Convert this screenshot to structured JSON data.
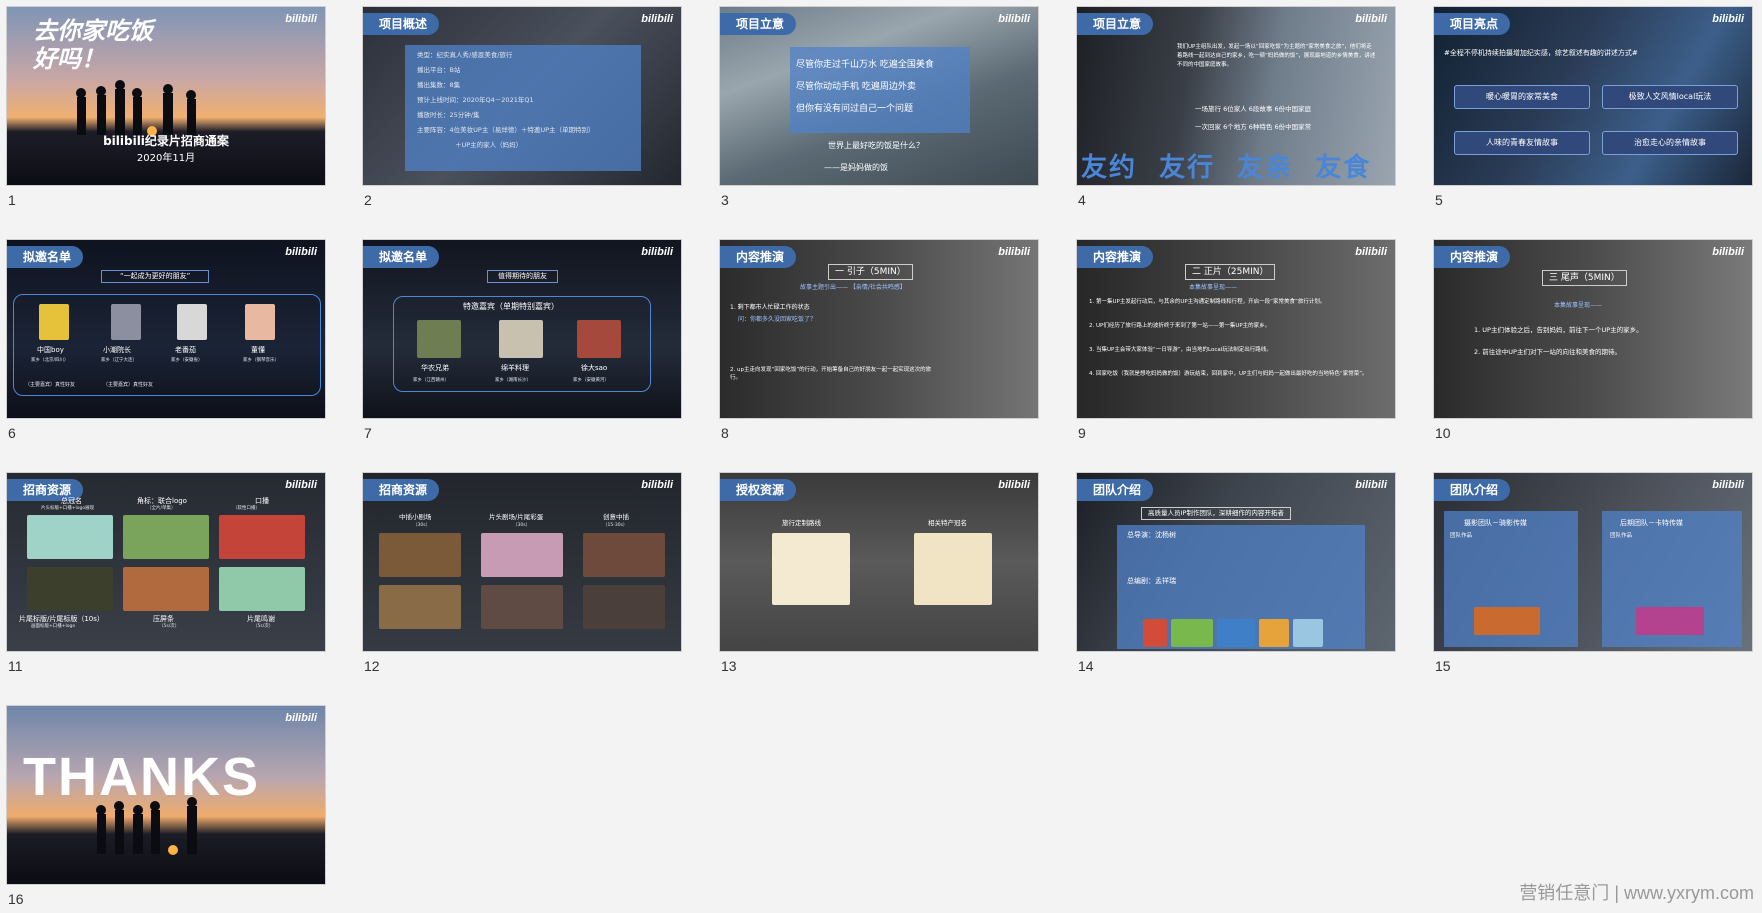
{
  "slides": [
    {
      "num": "1",
      "title_art": "去你家吃饭\n好吗！",
      "caption": "bilibili纪录片招商通案",
      "date": "2020年11月",
      "logo": "bilibili"
    },
    {
      "num": "2",
      "tag": "项目概述",
      "logo": "bilibili",
      "lines": [
        "类型：纪实真人秀/感恩美食/旅行",
        "播出平台：B站",
        "播出集数：8集",
        "预计上线时间：2020年Q4－2021年Q1",
        "播放时长：25分钟/集",
        "主要阵容：4位美妆UP主（易烊德）＋特邀UP主（单期特别）",
        "＋UP主的家人（妈妈）"
      ]
    },
    {
      "num": "3",
      "tag": "项目立意",
      "logo": "bilibili",
      "lines": [
        "尽管你走过千山万水 吃遍全国美食",
        "尽管你动动手机 吃遍周边外卖",
        "但你有没有问过自己一个问题"
      ],
      "q1": "世界上最好吃的饭是什么？",
      "q2": "——是妈妈做的饭"
    },
    {
      "num": "4",
      "tag": "项目立意",
      "logo": "bilibili",
      "intro": "我们UP主组队出发，发起一场以“回家吃饭”为主题的“家常美食之旅”，他们将走着路线一起到达自己的家乡，吃一顿“妈妈做的饭”，展现最地道的乡情美食，讲述不同的中国家庭故事。",
      "row1": "一场旅行 6位家人 6段故事 6份中国家庭",
      "row2": "一次回家 6个地方 6种特色 6份中国家常",
      "big": "友约  友行  友亲  友食"
    },
    {
      "num": "5",
      "tag": "项目亮点",
      "logo": "bilibili",
      "headline": "#全程不停机持续拍摄增加纪实感，综艺叙述有趣的讲述方式#",
      "cards": [
        "暖心暖胃的家常美食",
        "极致人文风情local玩法",
        "人味的青春友情故事",
        "治愈走心的亲情故事"
      ]
    },
    {
      "num": "6",
      "tag": "拟邀名单",
      "logo": "bilibili",
      "subtitle": "“一起成为更好的朋友”",
      "people": [
        {
          "name": "中国boy",
          "desc": "家乡（北京/四川）"
        },
        {
          "name": "小潮院长",
          "desc": "家乡（辽宁大连）"
        },
        {
          "name": "老番茄",
          "desc": "家乡（安徽省）"
        },
        {
          "name": "董懂",
          "desc": "家乡（钢琴音乐）"
        }
      ],
      "note_left": "（主要嘉宾）真性好友",
      "note_right": "（主要嘉宾）真性好友"
    },
    {
      "num": "7",
      "tag": "拟邀名单",
      "logo": "bilibili",
      "subtitle": "值得期待的朋友",
      "box_title": "特邀嘉宾（单期特别嘉宾）",
      "people": [
        {
          "name": "华农兄弟",
          "desc": "家乡（江西赣州）"
        },
        {
          "name": "绵羊料理",
          "desc": "家乡（湖南长沙）"
        },
        {
          "name": "徐大sao",
          "desc": "家乡（安徽黄河）"
        }
      ]
    },
    {
      "num": "8",
      "tag": "内容推演",
      "logo": "bilibili",
      "section": "一 引子（5MIN）",
      "theme": "故事主题引出—— 【亲情/社会共鸣感】",
      "points": [
        "1. 剩下都市人忙碌工作的状态",
        "问：你都多久没回家吃饭了？",
        "2. up主走向发现“回家吃饭”的行动，开始筹备自己的好朋友一起一起实现这次的旅行。"
      ]
    },
    {
      "num": "9",
      "tag": "内容推演",
      "logo": "bilibili",
      "section": "二 正片（25MIN）",
      "theme": "本集故事呈现——",
      "points": [
        "1. 第一集UP主发起行动后，与其余的UP主沟通定制路线和行程，开启一段“家常美食”旅行计划。",
        "2. UP们经历了旅行路上的波折终于来到了第一站——第一集UP主的家乡。",
        "3. 当集UP主会带大家体验“一日导游”，由当地的Local玩法制定出行路线。",
        "4. 回家吃饭（我就是想吃妈妈做的饭）游玩结束，回到家中，UP主们与妈妈一起做出最好吃的当地特色“家常菜”。"
      ]
    },
    {
      "num": "10",
      "tag": "内容推演",
      "logo": "bilibili",
      "section": "三 尾声（5MIN）",
      "theme": "本集故事呈现——",
      "points": [
        "1. UP主们体验之后，告别妈妈，前往下一个UP主的家乡。",
        "2. 前往途中UP主们对下一站的向往和美食的期待。"
      ]
    },
    {
      "num": "11",
      "tag": "招商资源",
      "logo": "bilibili",
      "items": [
        {
          "label": "总冠名",
          "sub": "片头标版+口播+logo展现"
        },
        {
          "label": "角标：联合logo",
          "sub": "（全片/单集）"
        },
        {
          "label": "口播",
          "sub": "（软性口播）"
        },
        {
          "label": "片尾标版/片尾标版（10s）",
          "sub": "画面标版+口播+logo"
        },
        {
          "label": "压屏条",
          "sub": "（5s/次）"
        },
        {
          "label": "片尾鸣谢",
          "sub": "（5s/次）"
        }
      ]
    },
    {
      "num": "12",
      "tag": "招商资源",
      "logo": "bilibili",
      "items": [
        {
          "label": "中插小剧场",
          "sub": "（30s）"
        },
        {
          "label": "片头剧场/片尾彩蛋",
          "sub": "（30s）"
        },
        {
          "label": "创意中插",
          "sub": "（15-30s）"
        }
      ]
    },
    {
      "num": "13",
      "tag": "授权资源",
      "logo": "bilibili",
      "items": [
        {
          "label": "旅行定制路线"
        },
        {
          "label": "相关特产冠名"
        }
      ]
    },
    {
      "num": "14",
      "tag": "团队介绍",
      "logo": "bilibili",
      "banner": "高质量人员IP制作团队，深耕细作的内容开拓者",
      "director": "总导演：沈杨树",
      "writer": "总编剧：孟祥瑞"
    },
    {
      "num": "15",
      "tag": "团队介绍",
      "logo": "bilibili",
      "left_title": "摄影团队－骑影传媒",
      "right_title": "后期团队－卡特传媒",
      "works": "团队作品"
    },
    {
      "num": "16",
      "big": "THANKS",
      "logo": "bilibili"
    }
  ],
  "watermark": "营销任意门 | www.yxrym.com"
}
